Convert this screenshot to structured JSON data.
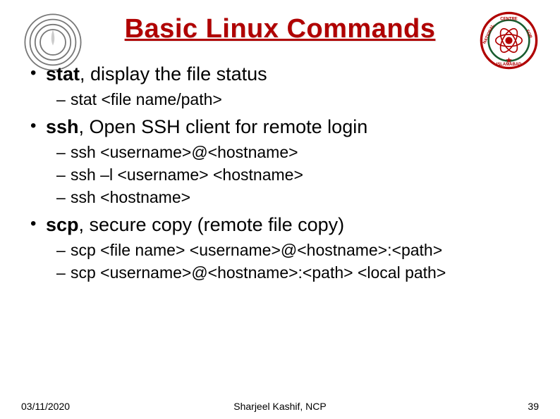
{
  "title": "Basic Linux Commands",
  "bullets": [
    {
      "cmd": "stat",
      "desc": ", display the file status",
      "sub": [
        "stat <file name/path>"
      ]
    },
    {
      "cmd": "ssh",
      "desc": ", Open SSH client for remote login",
      "sub": [
        "ssh <username>@<hostname>",
        "ssh –l <username> <hostname>",
        "ssh <hostname>"
      ]
    },
    {
      "cmd": "scp",
      "desc": ", secure copy (remote file copy)",
      "sub": [
        "scp <file name> <username>@<hostname>:<path>",
        "scp <username>@<hostname>:<path> <local path>"
      ]
    }
  ],
  "footer": {
    "date": "03/11/2020",
    "author": "Sharjeel Kashif, NCP",
    "page": "39"
  },
  "logos": {
    "left_alt": "aperture-logo",
    "right_alt": "ncp-badge"
  }
}
